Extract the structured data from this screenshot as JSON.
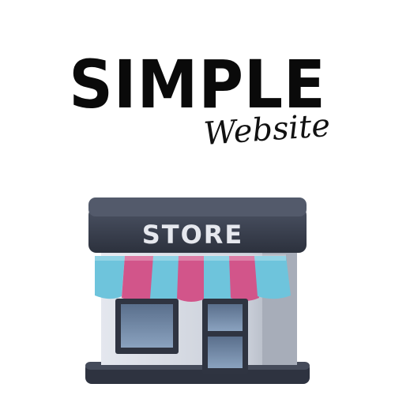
{
  "logo": {
    "title": "SIMPLE",
    "subtitle": "Website",
    "sign_text": "STORE",
    "icon": "storefront-icon"
  },
  "colors": {
    "text": "#0a0a0a",
    "roof": "#3a4050",
    "awning_blue": "#6ec4dc",
    "awning_pink": "#d2558a",
    "wall": "#c9ced8",
    "window": "#6f88a6"
  }
}
